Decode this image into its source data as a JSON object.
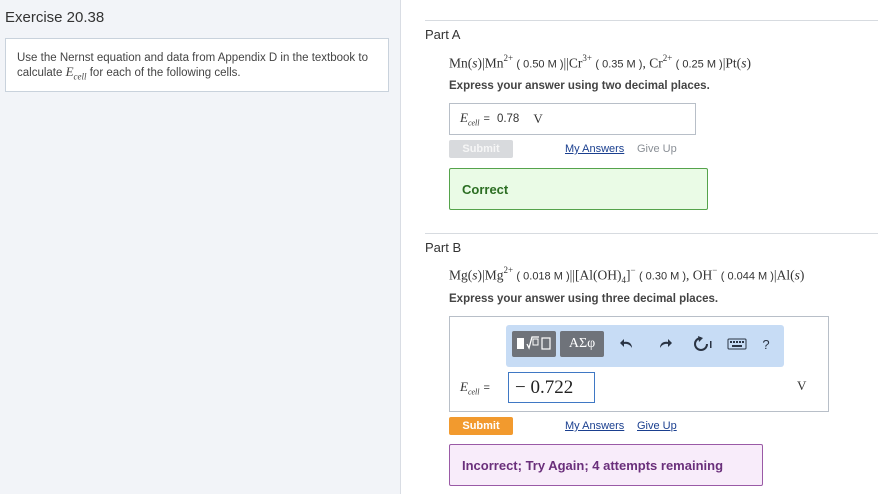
{
  "exercise": {
    "title": "Exercise 20.38",
    "instruction_before": "Use the Nernst equation and data from Appendix D in the textbook to calculate ",
    "instruction_var": "E",
    "instruction_var_sub": "cell",
    "instruction_after": " for each of the following cells."
  },
  "partA": {
    "label": "Part A",
    "eq": {
      "s1": "Mn(",
      "s1i": "s",
      "s2": ")|Mn",
      "s2sup": "2+",
      "c1": "( 0.50 M )",
      "s3": "||Cr",
      "s3sup": "3+",
      "c2": "( 0.35 M )",
      "s4": ", Cr",
      "s4sup": "2+",
      "c3": "( 0.25 M )",
      "s5": "|Pt(",
      "s5i": "s",
      "s6": ")"
    },
    "instruction": "Express your answer using two decimal places.",
    "var": "E",
    "var_sub": "cell",
    "eq_sign": "=",
    "value": "0.78",
    "unit": "V",
    "submit": "Submit",
    "my_answers": "My Answers",
    "give_up": "Give Up",
    "feedback": "Correct"
  },
  "partB": {
    "label": "Part B",
    "eq": {
      "s1": "Mg(",
      "s1i": "s",
      "s2": ")|Mg",
      "s2sup": "2+",
      "c1": "( 0.018 M )",
      "s3": "||[Al(OH)",
      "s3sub": "4",
      "s3b": "]",
      "s3sup": "−",
      "c2": "( 0.30 M )",
      "s4": ", OH",
      "s4sup": "−",
      "c3": "( 0.044 M )",
      "s5": "|Al(",
      "s5i": "s",
      "s6": ")"
    },
    "instruction": "Express your answer using three decimal places.",
    "toolbar": {
      "templates_icon": "templates-icon",
      "greek": "ΑΣφ",
      "undo_icon": "undo-icon",
      "redo_icon": "redo-icon",
      "reset_icon": "reset-icon",
      "keyboard_icon": "keyboard-icon",
      "help": "?"
    },
    "var": "E",
    "var_sub": "cell",
    "eq_sign": "=",
    "value": "− 0.722",
    "unit": "V",
    "submit": "Submit",
    "my_answers": "My Answers",
    "give_up": "Give Up",
    "feedback": "Incorrect; Try Again; 4 attempts remaining"
  },
  "colors": {
    "correct": "#2c6e23",
    "incorrect": "#6a2f7b",
    "submit_active": "#f29a2e",
    "link": "#1a3f8f",
    "toolbar_bg": "#c7dcf5"
  }
}
